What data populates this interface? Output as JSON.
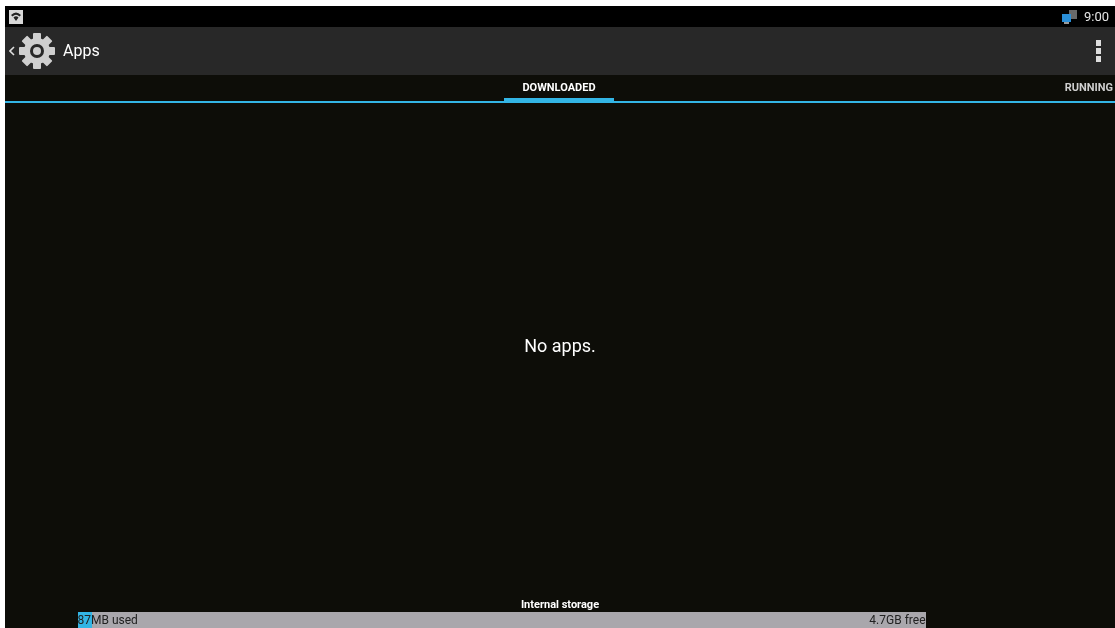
{
  "status_bar": {
    "time": "9:00"
  },
  "action_bar": {
    "title": "Apps"
  },
  "tabs": [
    {
      "label": "DOWNLOADED",
      "selected": true
    },
    {
      "label": "RUNNING",
      "selected": false
    }
  ],
  "empty_message": "No apps.",
  "storage": {
    "title": "Internal storage",
    "used": "87MB used",
    "free": "4.7GB free",
    "level": 0.017
  }
}
